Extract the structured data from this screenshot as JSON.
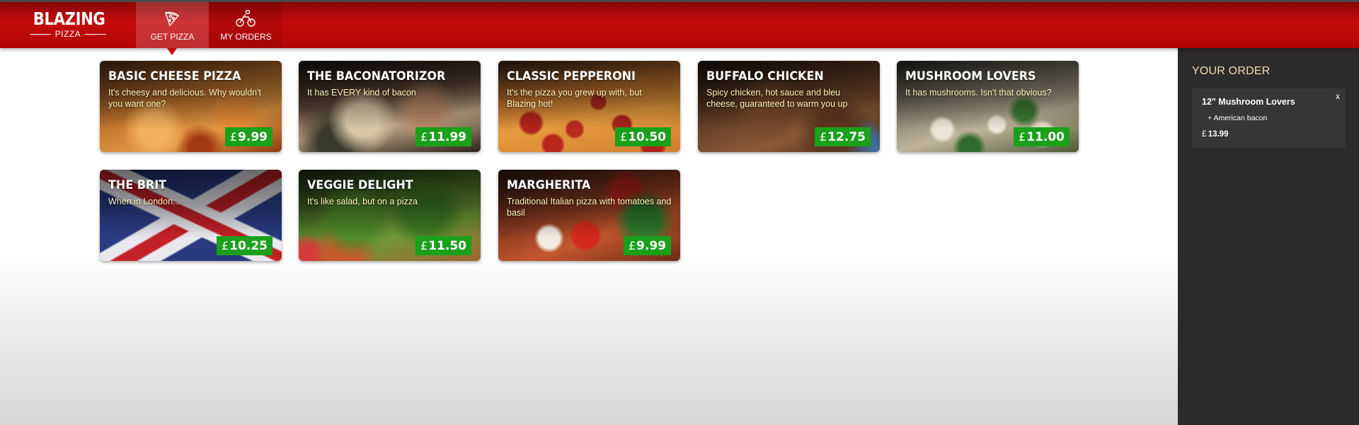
{
  "brand": {
    "name": "BLAZING",
    "sub": "PIZZA"
  },
  "nav": {
    "tabs": [
      {
        "label": "GET PIZZA",
        "icon": "pizza-slice-icon",
        "active": true
      },
      {
        "label": "MY ORDERS",
        "icon": "motorbike-icon",
        "active": false
      }
    ]
  },
  "colors": {
    "brand_red": "#c40b0b",
    "price_green": "#1aa01a",
    "sidebar_bg": "#2b2b2b",
    "description_text": "#fff2b8",
    "order_title": "#f3dcb2"
  },
  "currency_symbol": "£",
  "specials": [
    {
      "name": "BASIC CHEESE PIZZA",
      "description": "It's cheesy and delicious. Why wouldn't you want one?",
      "price": "9.99"
    },
    {
      "name": "THE BACONATORIZOR",
      "description": "It has EVERY kind of bacon",
      "price": "11.99"
    },
    {
      "name": "CLASSIC PEPPERONI",
      "description": "It's the pizza you grew up with, but Blazing hot!",
      "price": "10.50"
    },
    {
      "name": "BUFFALO CHICKEN",
      "description": "Spicy chicken, hot sauce and bleu cheese, guaranteed to warm you up",
      "price": "12.75"
    },
    {
      "name": "MUSHROOM LOVERS",
      "description": "It has mushrooms. Isn't that obvious?",
      "price": "11.00"
    },
    {
      "name": "THE BRIT",
      "description": "When in London...",
      "price": "10.25"
    },
    {
      "name": "VEGGIE DELIGHT",
      "description": "It's like salad, but on a pizza",
      "price": "11.50"
    },
    {
      "name": "MARGHERITA",
      "description": "Traditional Italian pizza with tomatoes and basil",
      "price": "9.99"
    }
  ],
  "order": {
    "title": "YOUR ORDER",
    "items": [
      {
        "name": "12\" Mushroom Lovers",
        "toppings": [
          "+ American bacon"
        ],
        "price": "13.99",
        "remove_label": "x"
      }
    ]
  }
}
